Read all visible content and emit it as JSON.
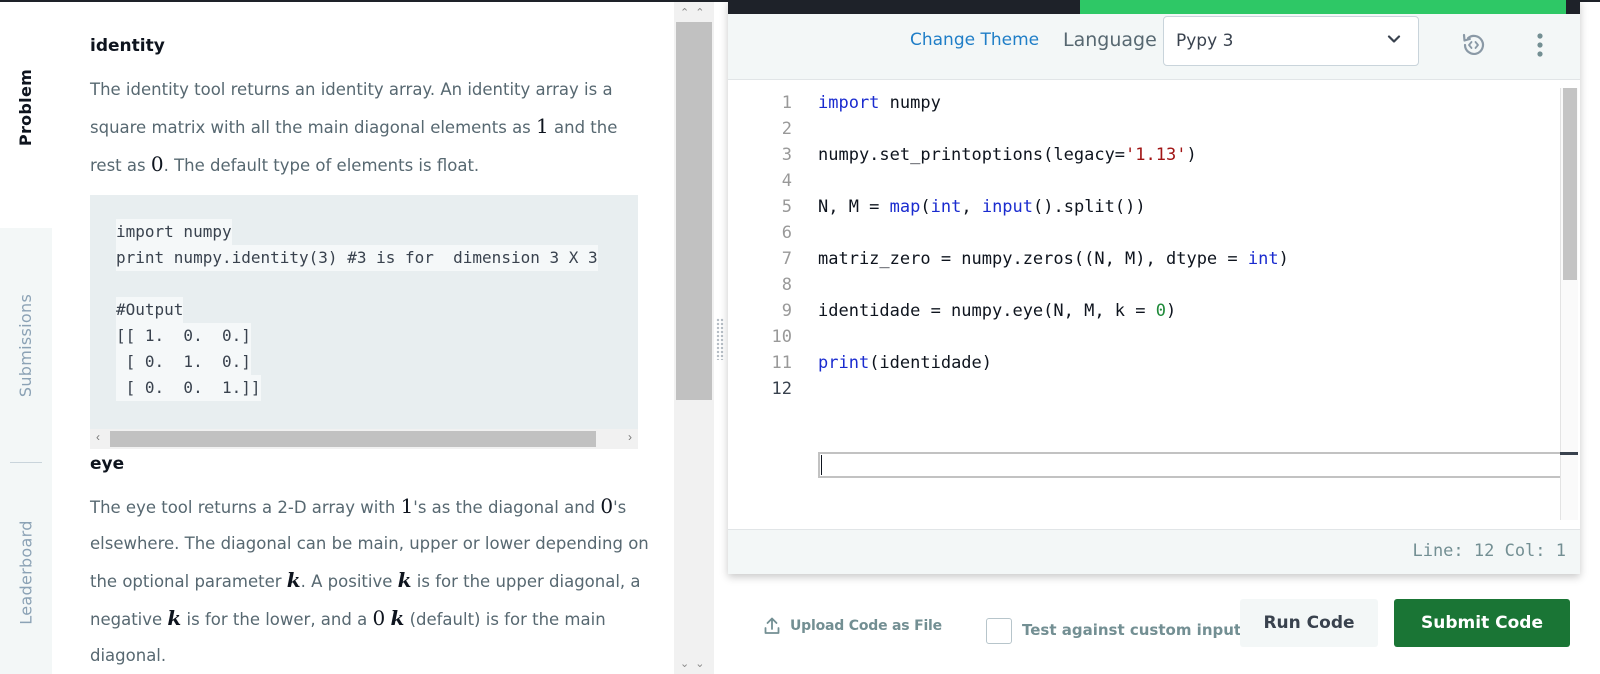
{
  "sidebar": {
    "tabs": [
      {
        "label": "Problem",
        "active": true
      },
      {
        "label": "Submissions",
        "active": false
      },
      {
        "label": "Leaderboard",
        "active": false
      }
    ]
  },
  "problem": {
    "section1": {
      "heading": "identity",
      "p1a": "The identity tool returns an identity array. An identity array is a square matrix with all the main diagonal elements as",
      "one": "1",
      "p1b": "and the rest as",
      "zero": "0",
      "p1c": ". The default type of elements is float."
    },
    "code_example": [
      "import numpy",
      "print numpy.identity(3) #3 is for  dimension 3 X 3",
      "",
      "#Output",
      "[[ 1.  0.  0.]",
      " [ 0.  1.  0.]",
      " [ 0.  0.  1.]]"
    ],
    "section2": {
      "heading": "eye",
      "t1": "The eye tool returns a 2-D array with",
      "m1": "1",
      "t2": "'s as the diagonal and",
      "m2": "0",
      "t3": "'s elsewhere. The diagonal can be main, upper or lower depending on the optional parameter",
      "k1": "k",
      "t4": ". A positive",
      "k2": "k",
      "t5": "is for the upper diagonal, a negative",
      "k3": "k",
      "t6": "is for the lower, and a",
      "m3": "0",
      "k4": "k",
      "t7": "(default) is for the main diagonal."
    }
  },
  "editor": {
    "progress_percent": 58,
    "change_theme": "Change Theme",
    "language_label": "Language",
    "language_value": "Pypy 3",
    "line_numbers": [
      "1",
      "2",
      "3",
      "4",
      "5",
      "6",
      "7",
      "8",
      "9",
      "10",
      "11",
      "12"
    ],
    "cursor_line": 12,
    "status": "Line: 12 Col: 1"
  },
  "actions": {
    "upload": "Upload Code as File",
    "custom_input": "Test against custom input",
    "run": "Run Code",
    "submit": "Submit Code"
  },
  "colors": {
    "accent_link": "#1f7ec7",
    "submit_green": "#1a7535",
    "progress_green": "#2ec866",
    "keyword_blue": "#1a2bcf",
    "string_red": "#a11515",
    "number_green": "#1f8a3a"
  },
  "icons": {
    "language_dropdown": "chevron-down-icon",
    "restore": "restore-code-icon",
    "more": "more-vertical-icon",
    "upload": "upload-icon"
  }
}
